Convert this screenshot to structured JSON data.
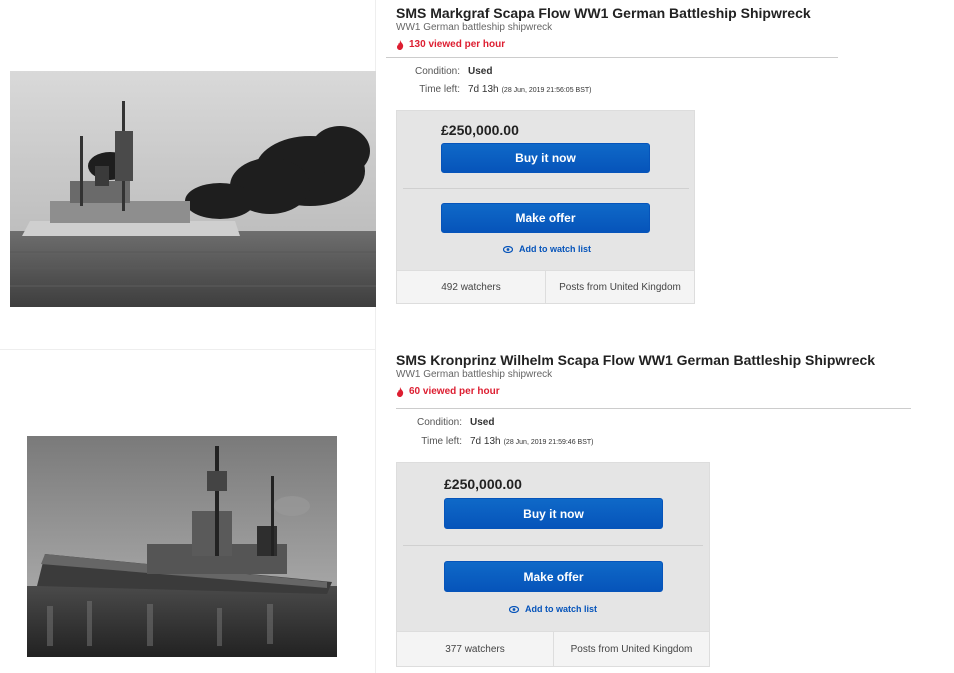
{
  "listings": [
    {
      "title": "SMS Markgraf Scapa Flow WW1 German Battleship Shipwreck",
      "subtitle": "WW1 German battleship shipwreck",
      "viewed": "130 viewed per hour",
      "condition_label": "Condition:",
      "condition_value": "Used",
      "time_label": "Time left:",
      "time_value": "7d 13h",
      "time_detail": "(28 Jun, 2019   21:56:05 BST)",
      "price": "£250,000.00",
      "buy_label": "Buy it now",
      "offer_label": "Make offer",
      "watch_label": "Add to watch list",
      "watchers": "492 watchers",
      "posts": "Posts from United Kingdom"
    },
    {
      "title": "SMS Kronprinz Wilhelm Scapa Flow WW1 German Battleship Shipwreck",
      "subtitle": "WW1 German battleship shipwreck",
      "viewed": "60 viewed per hour",
      "condition_label": "Condition:",
      "condition_value": "Used",
      "time_label": "Time left:",
      "time_value": "7d 13h",
      "time_detail": "(28 Jun, 2019   21:59:46 BST)",
      "price": "£250,000.00",
      "buy_label": "Buy it now",
      "offer_label": "Make offer",
      "watch_label": "Add to watch list",
      "watchers": "377 watchers",
      "posts": "Posts from United Kingdom"
    }
  ],
  "colors": {
    "accent_blue": "#0654ba",
    "hot_red": "#dd1e31",
    "panel_gray": "#e5e5e5"
  },
  "icons": {
    "hot": "flame-icon",
    "watch": "eye-icon"
  }
}
